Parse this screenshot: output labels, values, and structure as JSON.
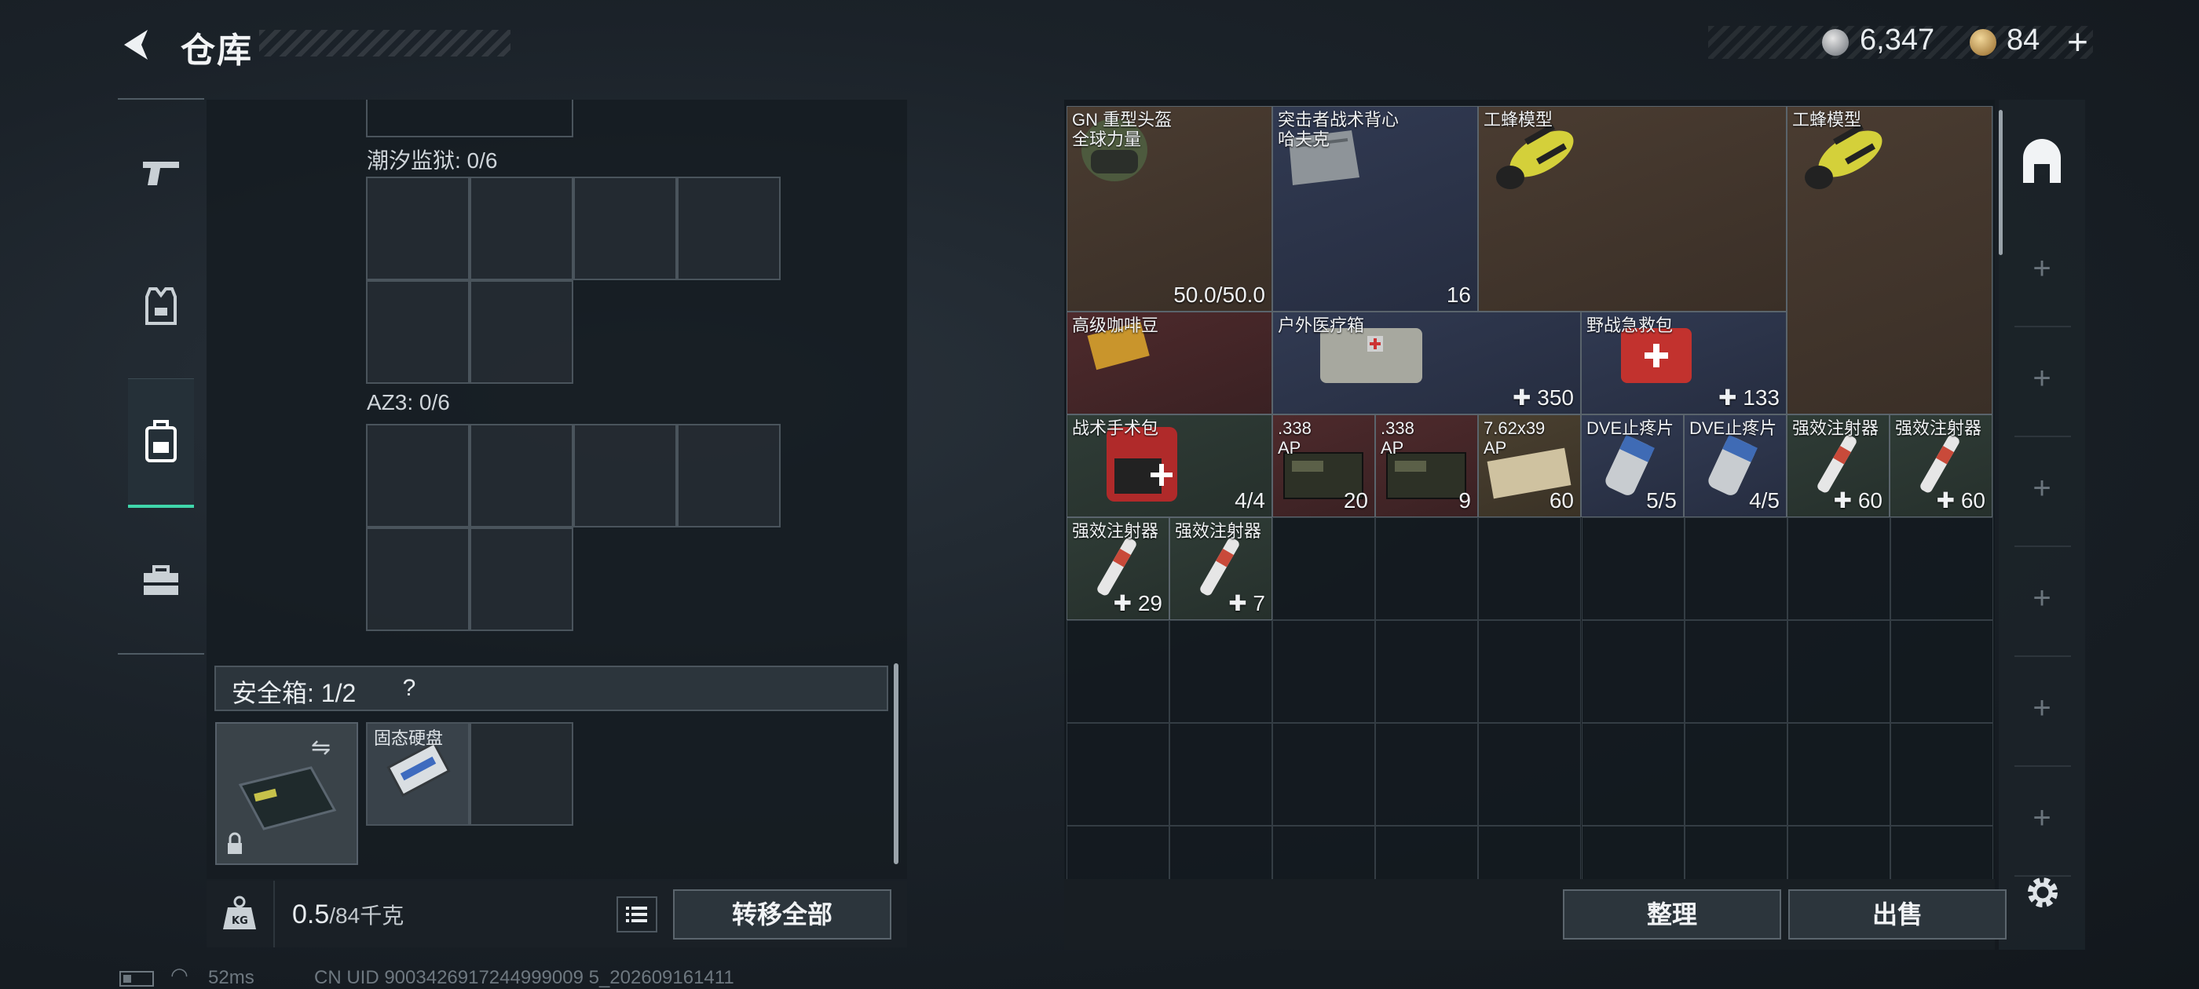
{
  "header": {
    "title": "仓库",
    "currency1": "6,347",
    "currency2": "84",
    "plus": "+"
  },
  "tabs": [
    "weapon",
    "armor",
    "backpack",
    "tools"
  ],
  "left": {
    "grid1_label": "潮汐监狱: 0/6",
    "grid2_label": "AZ3: 0/6",
    "safe_label": "安全箱: 1/2",
    "safe_help": "?",
    "ssd_label": "固态硬盘",
    "weight_value": "0.5",
    "weight_max": "/84千克",
    "transfer_all": "转移全部"
  },
  "stash": {
    "items": [
      {
        "name": "GN 重型头盔\n全球力量",
        "value": "50.0/50.0",
        "color": "brown"
      },
      {
        "name": "突击者战术背心\n哈夫克",
        "value": "16",
        "color": "blue"
      },
      {
        "name": "工蜂模型",
        "value": "",
        "color": "brown"
      },
      {
        "name": "工蜂模型",
        "value": "",
        "color": "brown"
      },
      {
        "name": "高级咖啡豆",
        "value": "",
        "color": "red"
      },
      {
        "name": "户外医疗箱",
        "value": "✚ 350",
        "color": "blue"
      },
      {
        "name": "野战急救包",
        "value": "✚ 133",
        "color": "blue"
      },
      {
        "name": "战术手术包",
        "value": "4/4",
        "color": "green"
      },
      {
        "name": ".338\nAP",
        "value": "20",
        "color": "red"
      },
      {
        "name": ".338\nAP",
        "value": "9",
        "color": "red"
      },
      {
        "name": "7.62x39\nAP",
        "value": "60",
        "color": "gold"
      },
      {
        "name": "DVE止疼片",
        "value": "5/5",
        "color": "blue"
      },
      {
        "name": "DVE止疼片",
        "value": "4/5",
        "color": "blue"
      },
      {
        "name": "强效注射器",
        "value": "✚ 60",
        "color": "green"
      },
      {
        "name": "强效注射器",
        "value": "✚ 60",
        "color": "green"
      },
      {
        "name": "强效注射器",
        "value": "✚ 29",
        "color": "green"
      },
      {
        "name": "强效注射器",
        "value": "✚ 7",
        "color": "green"
      }
    ]
  },
  "buttons": {
    "sort": "整理",
    "sell": "出售"
  },
  "status": {
    "ping": "52ms",
    "uid": "CN UID 9003426917244999009 5_202609161411"
  },
  "colors": {
    "accent": "#3fd6ab"
  }
}
